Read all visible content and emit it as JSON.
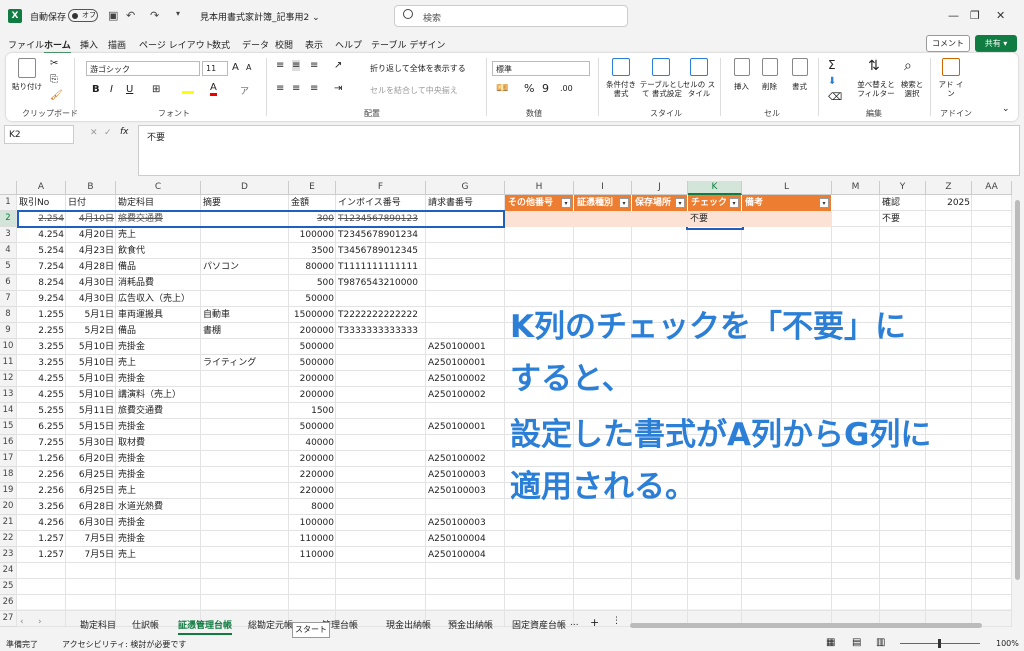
{
  "titlebar": {
    "app_logo": "X",
    "autosave_label": "自動保存",
    "toggle_label": "オフ",
    "document_title": "見本用書式家計簿_記事用2 ⌄",
    "search_placeholder": "検索"
  },
  "menu": {
    "tabs": [
      "ファイル",
      "ホーム",
      "挿入",
      "描画",
      "ページ レイアウト",
      "数式",
      "データ",
      "校閲",
      "表示",
      "ヘルプ",
      "テーブル デザイン"
    ],
    "comment_label": "コメント",
    "share_label": "共有 ▾"
  },
  "ribbon": {
    "paste_label": "貼り付け",
    "font_name": "游ゴシック",
    "font_size": "11",
    "wrap_label": "折り返して全体を表示する",
    "merge_label": "セルを結合して中央揃え",
    "number_format": "標準",
    "cond_format_label": "条件付き 書式",
    "table_format_label": "テーブルとして 書式設定",
    "cell_style_label": "セルの スタイル",
    "insert_label": "挿入",
    "delete_label": "削除",
    "format_label": "書式",
    "sort_label": "並べ替えと フィルター",
    "find_label": "検索と 選択",
    "addin_label": "アド イン",
    "groups": [
      "クリップボード",
      "フォント",
      "配置",
      "数値",
      "スタイル",
      "セル",
      "編集",
      "アドイン"
    ]
  },
  "formula_bar": {
    "name_box": "K2",
    "fx": "fx",
    "content": "不要"
  },
  "columns": [
    "A",
    "B",
    "C",
    "D",
    "E",
    "F",
    "G",
    "H",
    "I",
    "J",
    "K",
    "L",
    "M",
    "Y",
    "Z",
    "AA"
  ],
  "header_row": [
    "取引No",
    "日付",
    "勘定科目",
    "摘要",
    "金額",
    "インボイス番号",
    "請求書番号",
    "その他番号",
    "証憑種別",
    "保存場所",
    "チェック",
    "備考"
  ],
  "side_cells": {
    "y1": "確認",
    "z1": "2025",
    "y2": "不要"
  },
  "rows": [
    [
      "2.254",
      "4月10日",
      "旅費交通費",
      "",
      "300",
      "T1234567890123",
      ""
    ],
    [
      "4.254",
      "4月20日",
      "売上",
      "",
      "100000",
      "T2345678901234",
      ""
    ],
    [
      "5.254",
      "4月23日",
      "飲食代",
      "",
      "3500",
      "T3456789012345",
      ""
    ],
    [
      "7.254",
      "4月28日",
      "備品",
      "パソコン",
      "80000",
      "T1111111111111",
      ""
    ],
    [
      "8.254",
      "4月30日",
      "消耗品費",
      "",
      "500",
      "T9876543210000",
      ""
    ],
    [
      "9.254",
      "4月30日",
      "広告収入（売上）",
      "",
      "50000",
      "",
      ""
    ],
    [
      "1.255",
      "5月1日",
      "車両運搬具",
      "自動車",
      "1500000",
      "T2222222222222",
      ""
    ],
    [
      "2.255",
      "5月2日",
      "備品",
      "書棚",
      "200000",
      "T3333333333333",
      ""
    ],
    [
      "3.255",
      "5月10日",
      "売掛金",
      "",
      "500000",
      "",
      "A250100001"
    ],
    [
      "3.255",
      "5月10日",
      "売上",
      "ライティング",
      "500000",
      "",
      "A250100001"
    ],
    [
      "4.255",
      "5月10日",
      "売掛金",
      "",
      "200000",
      "",
      "A250100002"
    ],
    [
      "4.255",
      "5月10日",
      "講演料（売上）",
      "",
      "200000",
      "",
      "A250100002"
    ],
    [
      "5.255",
      "5月11日",
      "旅費交通費",
      "",
      "1500",
      "",
      ""
    ],
    [
      "6.255",
      "5月15日",
      "売掛金",
      "",
      "500000",
      "",
      "A250100001"
    ],
    [
      "7.255",
      "5月30日",
      "取材費",
      "",
      "40000",
      "",
      ""
    ],
    [
      "1.256",
      "6月20日",
      "売掛金",
      "",
      "200000",
      "",
      "A250100002"
    ],
    [
      "2.256",
      "6月25日",
      "売掛金",
      "",
      "220000",
      "",
      "A250100003"
    ],
    [
      "2.256",
      "6月25日",
      "売上",
      "",
      "220000",
      "",
      "A250100003"
    ],
    [
      "3.256",
      "6月28日",
      "水道光熱費",
      "",
      "8000",
      "",
      ""
    ],
    [
      "4.256",
      "6月30日",
      "売掛金",
      "",
      "100000",
      "",
      "A250100003"
    ],
    [
      "1.257",
      "7月5日",
      "売掛金",
      "",
      "110000",
      "",
      "A250100004"
    ],
    [
      "1.257",
      "7月5日",
      "売上",
      "",
      "110000",
      "",
      "A250100004"
    ]
  ],
  "row_numbers": [
    "1",
    "2",
    "3",
    "4",
    "5",
    "6",
    "7",
    "8",
    "9",
    "10",
    "11",
    "12",
    "13",
    "14",
    "15",
    "16",
    "17",
    "18",
    "19",
    "20",
    "21",
    "22",
    "23",
    "24",
    "25",
    "26",
    "27"
  ],
  "k2_value": "不要",
  "annotation": [
    "K列のチェックを「不要」に",
    "すると、",
    "設定した書式がA列からG列に",
    "適用される。"
  ],
  "sheet_tabs": [
    "勘定科目",
    "仕訳帳",
    "証憑管理台帳",
    "総勘定元帳",
    "管理台帳",
    "現金出納帳",
    "預金出納帳",
    "固定資産台帳",
    "..."
  ],
  "tooltip": "スタート",
  "status": {
    "ready": "準備完了",
    "accessibility": "アクセシビリティ: 検討が必要です",
    "zoom": "100%"
  },
  "colors": {
    "accent": "#107c41",
    "header_orange": "#ed7d31",
    "peach": "#fbe2d5",
    "annotation_blue": "#2b7fd6",
    "selection_blue": "#1f5fbf"
  }
}
